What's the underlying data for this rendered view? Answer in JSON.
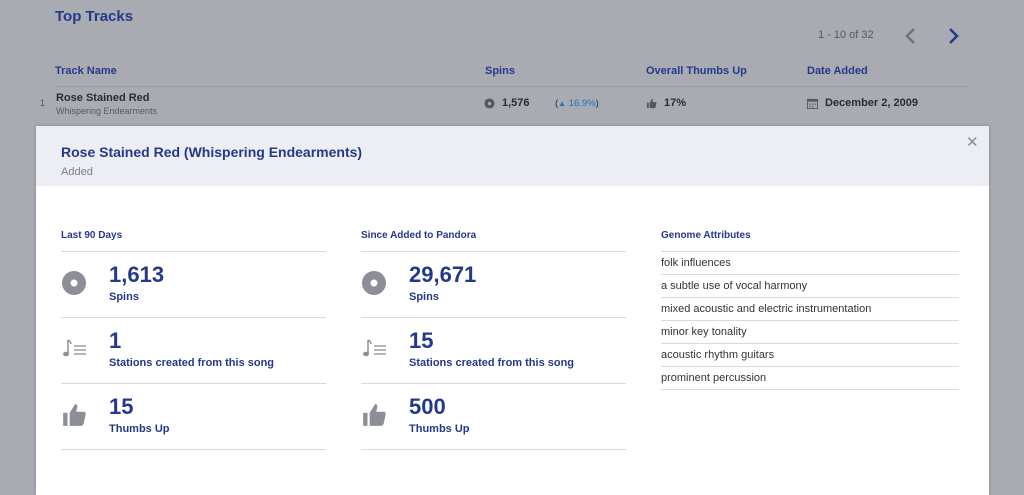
{
  "background": {
    "title": "Top Tracks",
    "pager": "1 - 10 of 32",
    "columns": [
      "Track Name",
      "Spins",
      "Overall Thumbs Up",
      "Date Added"
    ],
    "row": {
      "number": "1",
      "name": "Rose Stained Red",
      "artist": "Whispering Endearments",
      "spins": "1,576",
      "change": "16.9%",
      "thumbs": "17%",
      "date": "December 2, 2009"
    }
  },
  "panel": {
    "title": "Rose Stained Red (Whispering Endearments)",
    "subtitle": "Added",
    "last90": {
      "title": "Last 90 Days",
      "spins": {
        "value": "1,613",
        "label": "Spins"
      },
      "stations": {
        "value": "1",
        "label": "Stations created from this song"
      },
      "thumbs": {
        "value": "15",
        "label": "Thumbs Up"
      }
    },
    "since": {
      "title": "Since Added to Pandora",
      "spins": {
        "value": "29,671",
        "label": "Spins"
      },
      "stations": {
        "value": "15",
        "label": "Stations created from this song"
      },
      "thumbs": {
        "value": "500",
        "label": "Thumbs Up"
      }
    },
    "genome": {
      "title": "Genome Attributes",
      "items": [
        "folk influences",
        "a subtle use of vocal harmony",
        "mixed acoustic and electric instrumentation",
        "minor key tonality",
        "acoustic rhythm guitars",
        "prominent percussion"
      ]
    }
  },
  "colors": {
    "accent": "#24398a",
    "positive": "#1f70c0",
    "overlay": "#a9abb2"
  }
}
